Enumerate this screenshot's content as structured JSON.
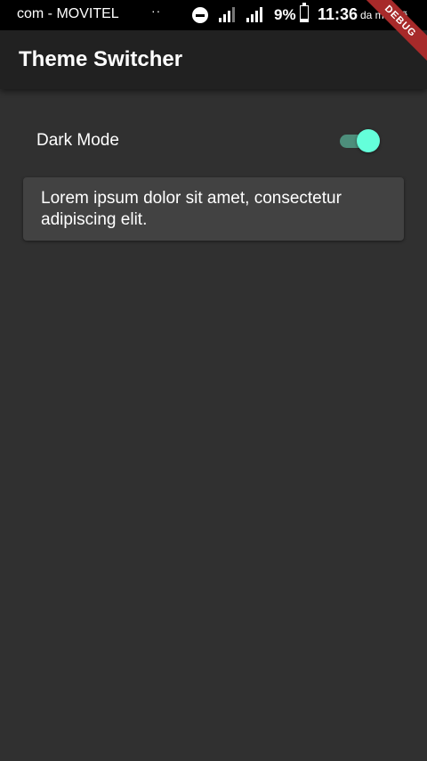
{
  "status_bar": {
    "carrier": "com - MOVITEL",
    "dots": "··",
    "battery_percent": "9%",
    "time": "11:36",
    "time_suffix": "da manhã",
    "icons": [
      "do-not-disturb-icon",
      "signal-icon",
      "signal-icon",
      "battery-charging-icon"
    ]
  },
  "debug_banner": "DEBUG",
  "app_bar": {
    "title": "Theme Switcher"
  },
  "settings": {
    "dark_mode_label": "Dark Mode",
    "dark_mode_enabled": true
  },
  "card": {
    "text": "Lorem ipsum dolor sit amet, consectetur adipiscing elit."
  },
  "colors": {
    "background": "#303030",
    "app_bar": "#212121",
    "card": "#424242",
    "switch_thumb": "#64ffda",
    "switch_track": "#4d8e7b",
    "debug_banner": "#a72a2a"
  }
}
